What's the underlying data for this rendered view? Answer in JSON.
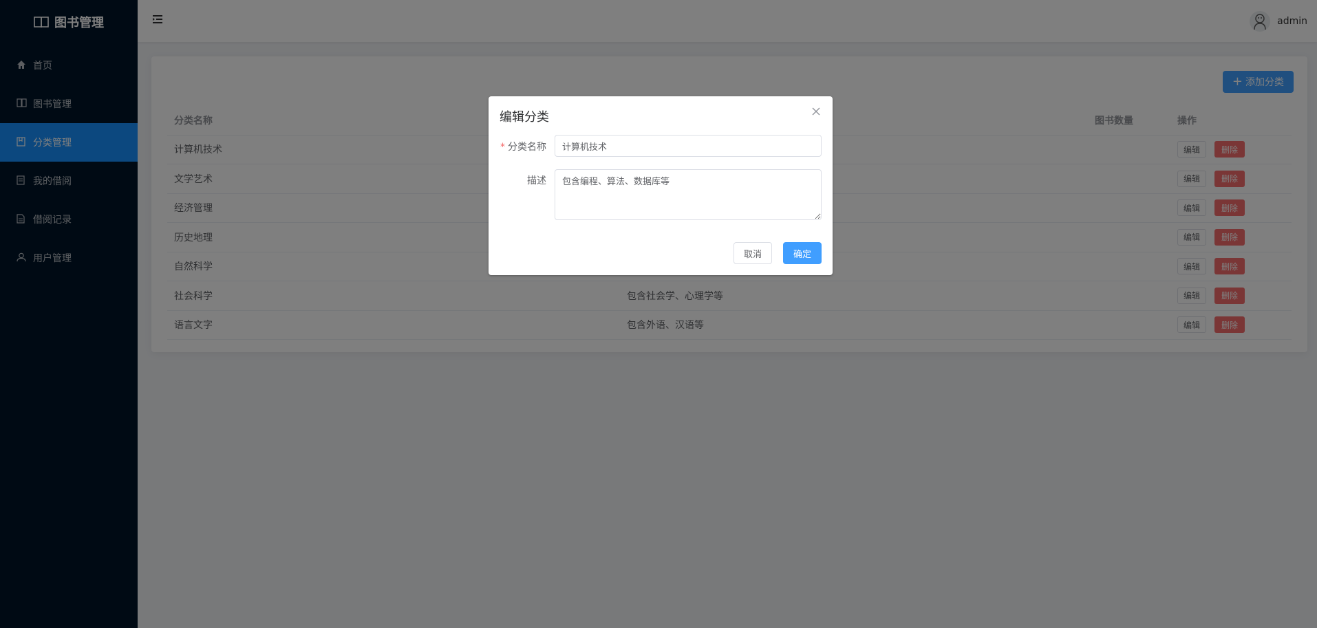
{
  "app": {
    "title": "图书管理"
  },
  "sidebar": {
    "items": [
      {
        "label": "首页",
        "icon": "home-icon",
        "active": false
      },
      {
        "label": "图书管理",
        "icon": "book-icon",
        "active": false
      },
      {
        "label": "分类管理",
        "icon": "category-icon",
        "active": true
      },
      {
        "label": "我的借阅",
        "icon": "borrow-icon",
        "active": false
      },
      {
        "label": "借阅记录",
        "icon": "record-icon",
        "active": false
      },
      {
        "label": "用户管理",
        "icon": "user-icon",
        "active": false
      }
    ]
  },
  "header": {
    "username": "admin"
  },
  "toolbar": {
    "add_label": "添加分类"
  },
  "table": {
    "columns": {
      "name": "分类名称",
      "count": "图书数量",
      "op": "操作"
    },
    "edit_label": "编辑",
    "delete_label": "删除",
    "rows": [
      {
        "name": "计算机技术",
        "desc": ""
      },
      {
        "name": "文学艺术",
        "desc": ""
      },
      {
        "name": "经济管理",
        "desc": ""
      },
      {
        "name": "历史地理",
        "desc": ""
      },
      {
        "name": "自然科学",
        "desc": ""
      },
      {
        "name": "社会科学",
        "desc": "包含社会学、心理学等"
      },
      {
        "name": "语言文字",
        "desc": "包含外语、汉语等"
      }
    ]
  },
  "dialog": {
    "title": "编辑分类",
    "name_label": "分类名称",
    "name_value": "计算机技术",
    "desc_label": "描述",
    "desc_value": "包含编程、算法、数据库等",
    "cancel_label": "取消",
    "ok_label": "确定"
  },
  "colors": {
    "sidebar_bg": "#001529",
    "active": "#1890ff",
    "primary": "#409eff",
    "danger": "#f56c6c"
  }
}
